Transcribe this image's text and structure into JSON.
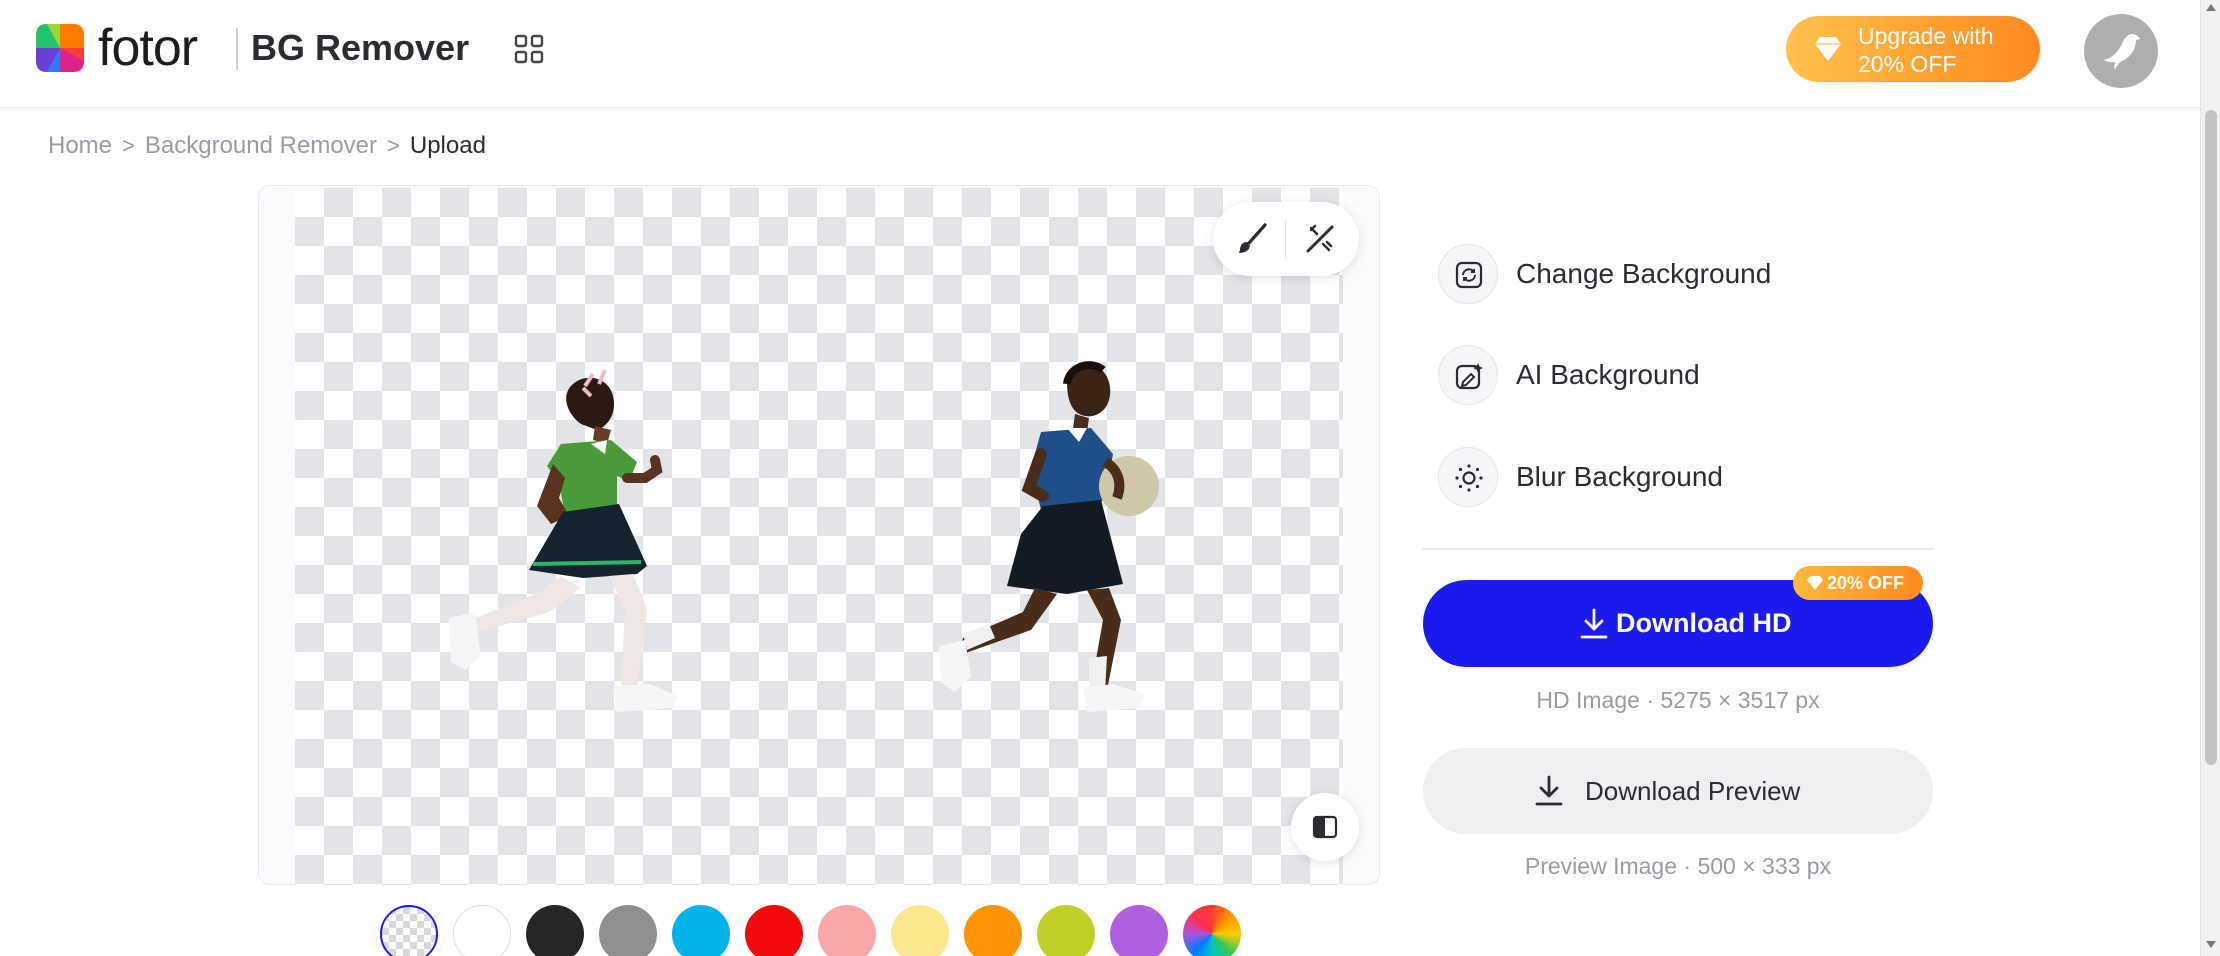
{
  "header": {
    "logo_text": "fotor",
    "product_name": "BG Remover",
    "apps_icon": "grid-apps-icon",
    "upgrade_label": "Upgrade with 20% OFF",
    "upgrade_icon": "diamond-icon",
    "avatar_icon": "bird-avatar-icon"
  },
  "breadcrumb": {
    "items": [
      "Home",
      "Background Remover"
    ],
    "current": "Upload",
    "separator": ">"
  },
  "canvas": {
    "tools": [
      "brush-icon",
      "magic-eraser-icon"
    ],
    "compare_icon": "compare-icon"
  },
  "swatches": {
    "selected_index": 0,
    "colors": [
      "transparent",
      "#ffffff",
      "#262626",
      "#8e9090",
      "#00b4ea",
      "#f30a0c",
      "#f9a7a8",
      "#fbe88f",
      "#fe9306",
      "#c2cf29",
      "#b05fe0",
      "rainbow"
    ]
  },
  "panel": {
    "options": [
      {
        "label": "Change Background",
        "icon": "change-background-icon"
      },
      {
        "label": "AI Background",
        "icon": "ai-background-icon"
      },
      {
        "label": "Blur Background",
        "icon": "blur-background-icon"
      }
    ],
    "download_hd": {
      "label": "Download HD",
      "badge": "20% OFF",
      "info": "HD Image · 5275 × 3517 px"
    },
    "download_preview": {
      "label": "Download Preview",
      "info": "Preview Image · 500 × 333 px"
    }
  },
  "colors": {
    "primary": "#1b1bef",
    "upgrade_orange": "#ff9f2e"
  }
}
